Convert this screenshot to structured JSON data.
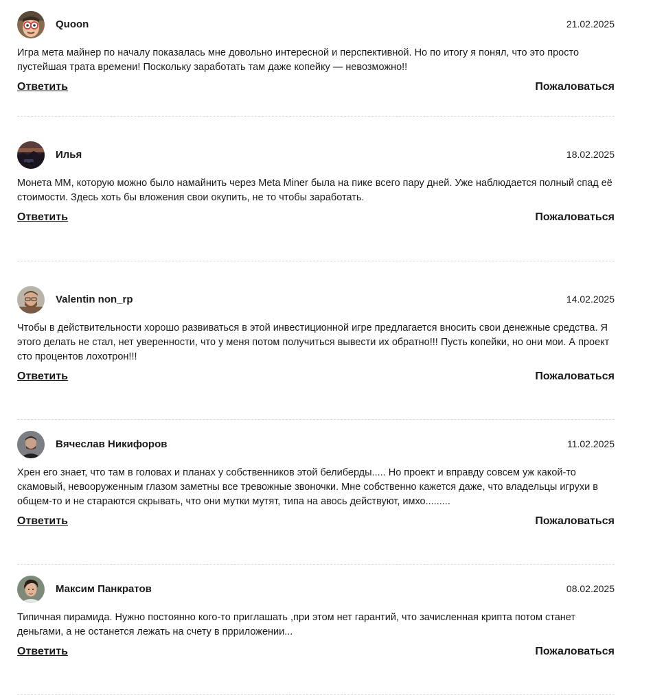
{
  "comments": [
    {
      "author": "Quoon",
      "date": "21.02.2025",
      "text": "Игра мета майнер по началу показалась мне довольно интересной и перспективной. Но по итогу я понял, что это просто пустейшая трата времени! Поскольку заработать там даже копейку — невозможно!!",
      "reply_label": "Ответить",
      "report_label": "Пожаловаться",
      "avatar_icon": "avatar-glasses-person"
    },
    {
      "author": "Илья",
      "date": "18.02.2025",
      "text": "Монета ММ, которую можно было намайнить через Meta Miner была на пике всего пару дней. Уже наблюдается полный спад её стоимости. Здесь хоть бы вложения свои окупить, не то чтобы заработать.",
      "reply_label": "Ответить",
      "report_label": "Пожаловаться",
      "avatar_icon": "avatar-dark-landscape"
    },
    {
      "author": "Valentin non_rp",
      "date": "14.02.2025",
      "text": "Чтобы в действительности хорошо развиваться в этой инвестиционной игре предлагается вносить свои денежные средства. Я этого делать не стал, нет уверенности, что у меня потом получиться вывести их обратно!!! Пусть копейки, но они мои. А проект сто процентов лохотрон!!!",
      "reply_label": "Ответить",
      "report_label": "Пожаловаться",
      "avatar_icon": "avatar-bearded-man"
    },
    {
      "author": "Вячеслав Никифоров",
      "date": "11.02.2025",
      "text": "Хрен его знает, что там в головах и планах у собственников этой белиберды..... Но проект и вправду совсем уж какой-то скамовый, невооруженным глазом заметны все тревожные звоночки. Мне собственно кажется даже, что владельцы игрухи в общем-то и не стараются скрывать, что они мутки мутят, типа на авось действуют, имхо.........",
      "reply_label": "Ответить",
      "report_label": "Пожаловаться",
      "avatar_icon": "avatar-man-dark-shirt"
    },
    {
      "author": "Максим Панкратов",
      "date": "08.02.2025",
      "text": "Типичная пирамида. Нужно постоянно кого-то приглашать ,при этом нет гарантий, что зачисленная крипта потом станет деньгами, а не останется лежать на счету в прриложении...",
      "reply_label": "Ответить",
      "report_label": "Пожаловаться",
      "avatar_icon": "avatar-young-man"
    }
  ]
}
